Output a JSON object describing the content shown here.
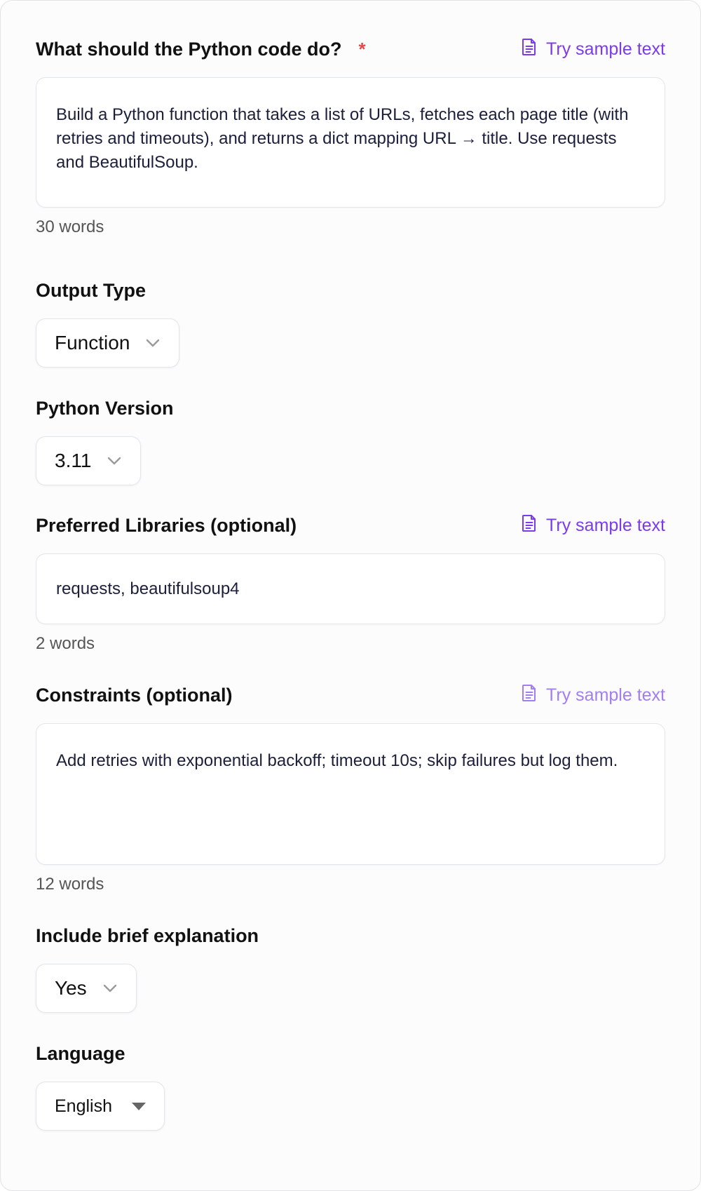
{
  "sample_link_text": "Try sample text",
  "colors": {
    "accent": "#7c3aed",
    "required": "#e5484d"
  },
  "task": {
    "label": "What should the Python code do?",
    "required_mark": "*",
    "value": "Build a Python function that takes a list of URLs, fetches each page title (with retries and timeouts), and returns a dict mapping URL → title. Use requests and BeautifulSoup.",
    "word_count": "30 words"
  },
  "output_type": {
    "label": "Output Type",
    "value": "Function"
  },
  "python_version": {
    "label": "Python Version",
    "value": "3.11"
  },
  "libraries": {
    "label": "Preferred Libraries (optional)",
    "value": "requests, beautifulsoup4",
    "word_count": "2 words"
  },
  "constraints": {
    "label": "Constraints (optional)",
    "value": "Add retries with exponential backoff; timeout 10s; skip failures but log them.",
    "word_count": "12 words"
  },
  "explanation": {
    "label": "Include brief explanation",
    "value": "Yes"
  },
  "language": {
    "label": "Language",
    "value": "English"
  },
  "icons": {
    "sample": "document-icon",
    "dropdown": "chevron-down-icon",
    "language_dropdown": "caret-down-icon"
  }
}
